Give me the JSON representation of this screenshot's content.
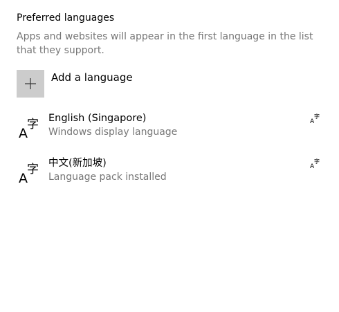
{
  "section": {
    "title": "Preferred languages",
    "description": "Apps and websites will appear in the first language in the list that they support."
  },
  "add_language": {
    "label": "Add a language",
    "icon": "plus-icon",
    "tile_color": "#cccccc"
  },
  "icon_glyphs": {
    "latin": "A",
    "cjk": "字"
  },
  "languages": [
    {
      "name": "English (Singapore)",
      "status": "Windows display language",
      "icon": "language-icon",
      "feature_icon": "display-language-feature-icon"
    },
    {
      "name": "中文(新加坡)",
      "status": "Language pack installed",
      "icon": "language-icon",
      "feature_icon": "display-language-feature-icon"
    }
  ],
  "colors": {
    "primary_text": "#000000",
    "secondary_text": "#767676",
    "background": "#ffffff"
  }
}
